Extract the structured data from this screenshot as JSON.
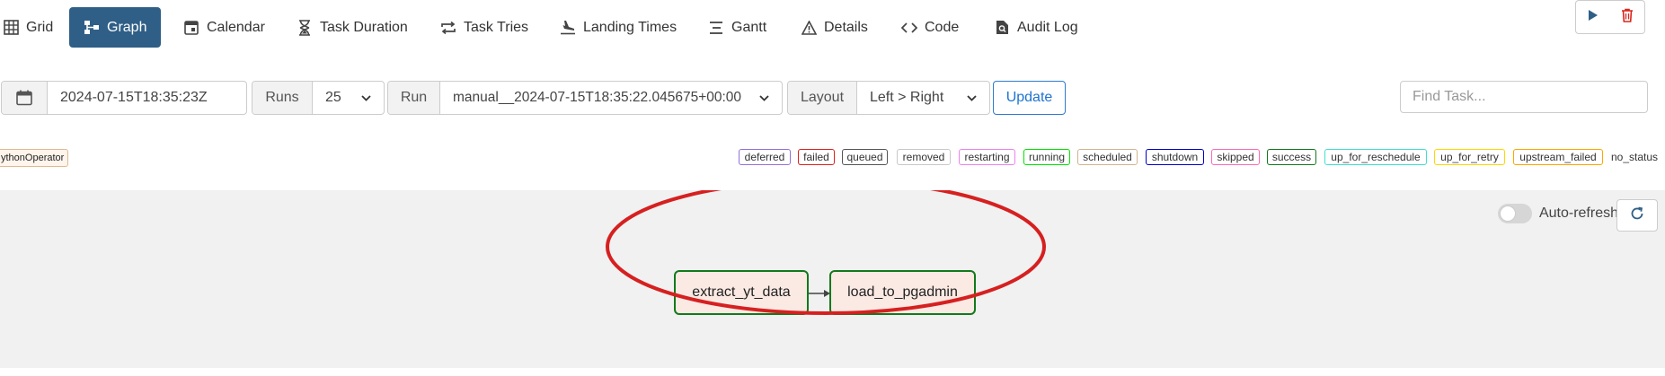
{
  "tabs": [
    {
      "label": "Grid",
      "icon": "grid-icon"
    },
    {
      "label": "Graph",
      "icon": "graph-icon",
      "active": true
    },
    {
      "label": "Calendar",
      "icon": "calendar-icon"
    },
    {
      "label": "Task Duration",
      "icon": "hourglass-icon"
    },
    {
      "label": "Task Tries",
      "icon": "repeat-icon"
    },
    {
      "label": "Landing Times",
      "icon": "plane-landing-icon"
    },
    {
      "label": "Gantt",
      "icon": "gantt-icon"
    },
    {
      "label": "Details",
      "icon": "warning-triangle-icon"
    },
    {
      "label": "Code",
      "icon": "code-icon"
    },
    {
      "label": "Audit Log",
      "icon": "file-search-icon"
    }
  ],
  "actions": {
    "trigger_icon": "play-icon",
    "delete_icon": "trash-icon",
    "trigger_color": "#2f5f87",
    "delete_color": "#d9261c"
  },
  "controls": {
    "date": "2024-07-15T18:35:23Z",
    "runs_label": "Runs",
    "runs_value": "25",
    "run_label": "Run",
    "run_value": "manual__2024-07-15T18:35:22.045675+00:00",
    "layout_label": "Layout",
    "layout_value": "Left > Right",
    "update_label": "Update",
    "find_placeholder": "Find Task..."
  },
  "legend": {
    "operator": "ythonOperator",
    "states": [
      {
        "label": "deferred",
        "color": "#9370db"
      },
      {
        "label": "failed",
        "color": "#e0201c"
      },
      {
        "label": "queued",
        "color": "#555555"
      },
      {
        "label": "removed",
        "color": "#c8c8c8"
      },
      {
        "label": "restarting",
        "color": "#ee82ee"
      },
      {
        "label": "running",
        "color": "#00e600"
      },
      {
        "label": "scheduled",
        "color": "#d2b48c"
      },
      {
        "label": "shutdown",
        "color": "#0000cc"
      },
      {
        "label": "skipped",
        "color": "#ff69b4"
      },
      {
        "label": "success",
        "color": "#117a1b"
      },
      {
        "label": "up_for_reschedule",
        "color": "#40e0d0"
      },
      {
        "label": "up_for_retry",
        "color": "#ffd700"
      },
      {
        "label": "upstream_failed",
        "color": "#ffa500"
      }
    ],
    "no_status": "no_status"
  },
  "graph": {
    "auto_refresh_label": "Auto-refresh",
    "auto_refresh_on": false,
    "nodes": [
      {
        "label": "extract_yt_data",
        "state": "success"
      },
      {
        "label": "load_to_pgadmin",
        "state": "success"
      }
    ],
    "annotation_color": "#d62020"
  }
}
